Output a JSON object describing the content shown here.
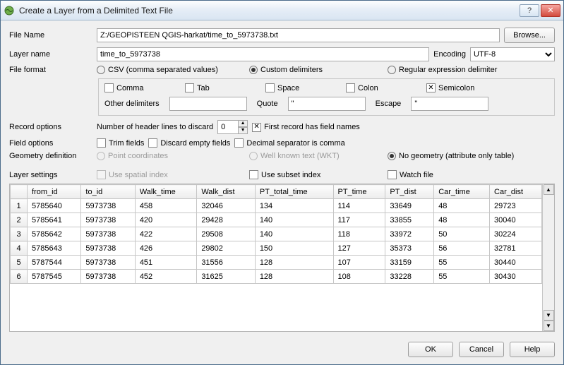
{
  "window": {
    "title": "Create a Layer from a Delimited Text File"
  },
  "fileRow": {
    "label": "File Name",
    "value": "Z:/GEOPISTEEN QGIS-harkat/time_to_5973738.txt",
    "browse": "Browse..."
  },
  "layerRow": {
    "label": "Layer name",
    "value": "time_to_5973738",
    "encodingLabel": "Encoding",
    "encodingValue": "UTF-8"
  },
  "fileFormat": {
    "label": "File format",
    "csv": "CSV (comma separated values)",
    "custom": "Custom delimiters",
    "regex": "Regular expression delimiter",
    "comma": "Comma",
    "tab": "Tab",
    "space": "Space",
    "colon": "Colon",
    "semicolon": "Semicolon",
    "otherLabel": "Other delimiters",
    "otherValue": "",
    "quoteLabel": "Quote",
    "quoteValue": "\"",
    "escapeLabel": "Escape",
    "escapeValue": "\""
  },
  "recordOptions": {
    "label": "Record options",
    "discardLabel": "Number of header lines to discard",
    "discardValue": "0",
    "firstRecord": "First record has field names"
  },
  "fieldOptions": {
    "label": "Field options",
    "trim": "Trim fields",
    "discardEmpty": "Discard empty fields",
    "decimalComma": "Decimal separator is comma"
  },
  "geometry": {
    "label": "Geometry definition",
    "point": "Point coordinates",
    "wkt": "Well known text (WKT)",
    "none": "No geometry (attribute only table)"
  },
  "layerSettings": {
    "label": "Layer settings",
    "spatial": "Use spatial index",
    "subset": "Use subset index",
    "watch": "Watch file"
  },
  "table": {
    "headers": [
      "from_id",
      "to_id",
      "Walk_time",
      "Walk_dist",
      "PT_total_time",
      "PT_time",
      "PT_dist",
      "Car_time",
      "Car_dist"
    ],
    "rows": [
      [
        "5785640",
        "5973738",
        "458",
        "32046",
        "134",
        "114",
        "33649",
        "48",
        "29723"
      ],
      [
        "5785641",
        "5973738",
        "420",
        "29428",
        "140",
        "117",
        "33855",
        "48",
        "30040"
      ],
      [
        "5785642",
        "5973738",
        "422",
        "29508",
        "140",
        "118",
        "33972",
        "50",
        "30224"
      ],
      [
        "5785643",
        "5973738",
        "426",
        "29802",
        "150",
        "127",
        "35373",
        "56",
        "32781"
      ],
      [
        "5787544",
        "5973738",
        "451",
        "31556",
        "128",
        "107",
        "33159",
        "55",
        "30440"
      ],
      [
        "5787545",
        "5973738",
        "452",
        "31625",
        "128",
        "108",
        "33228",
        "55",
        "30430"
      ]
    ]
  },
  "buttons": {
    "ok": "OK",
    "cancel": "Cancel",
    "help": "Help"
  }
}
